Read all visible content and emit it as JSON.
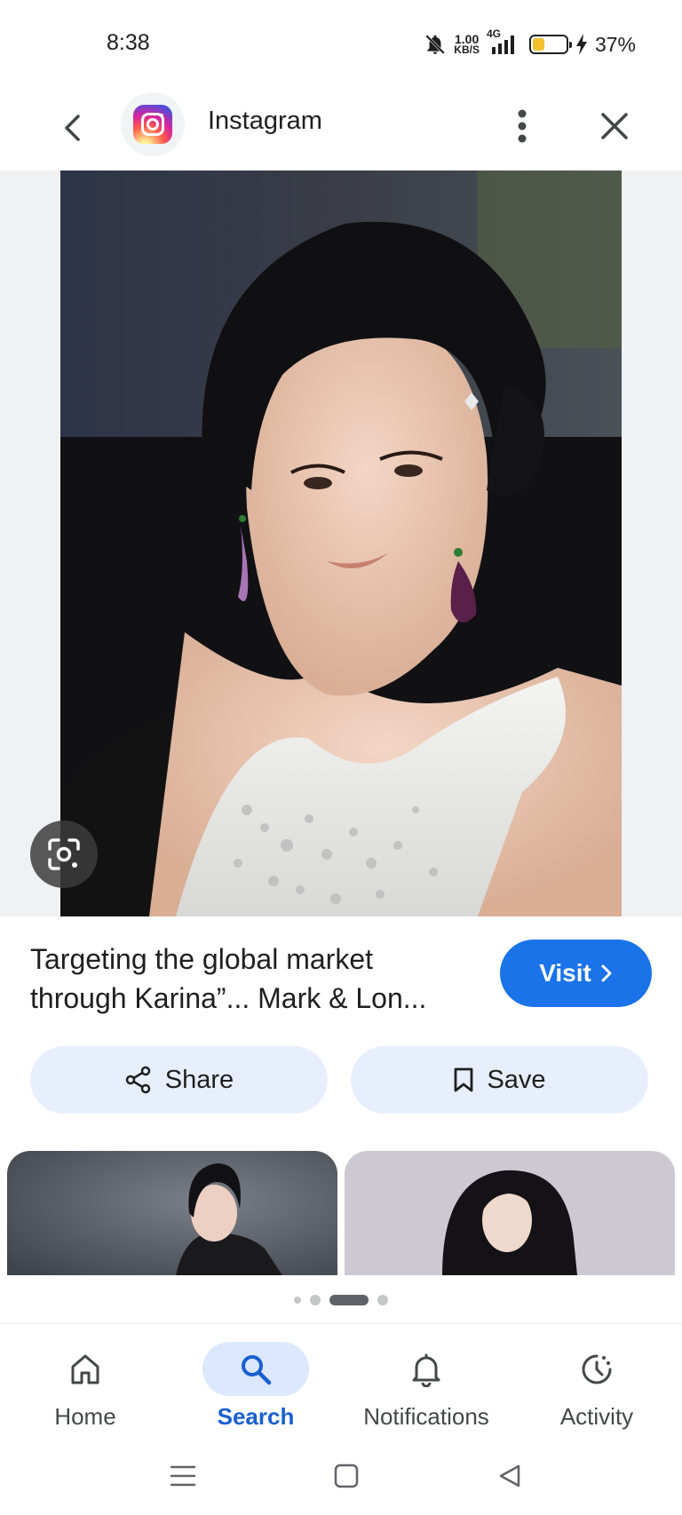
{
  "status_bar": {
    "time": "8:38",
    "net_speed_value": "1.00",
    "net_speed_unit": "KB/S",
    "network_type": "4G",
    "battery_percent": "37%",
    "battery_level": 0.37,
    "icons": [
      "bell-off-icon",
      "signal-icon",
      "battery-icon",
      "charging-bolt-icon"
    ]
  },
  "header": {
    "site_name": "Instagram",
    "icons": [
      "back-arrow-icon",
      "instagram-logo",
      "more-vert-icon",
      "close-icon"
    ]
  },
  "result": {
    "title": "Targeting the global market through Karina”... Mark & Lon...",
    "visit_label": "Visit"
  },
  "actions": {
    "share_label": "Share",
    "save_label": "Save"
  },
  "pagination": {
    "total": 4,
    "active_index": 2
  },
  "bottom_nav": {
    "items": [
      {
        "label": "Home",
        "icon": "home-icon"
      },
      {
        "label": "Search",
        "icon": "search-icon",
        "active": true
      },
      {
        "label": "Notifications",
        "icon": "bell-icon"
      },
      {
        "label": "Activity",
        "icon": "activity-icon"
      }
    ]
  },
  "colors": {
    "accent": "#1a73e8",
    "action_bg": "#e8effc",
    "nav_active_bg": "#dbe8fd"
  }
}
